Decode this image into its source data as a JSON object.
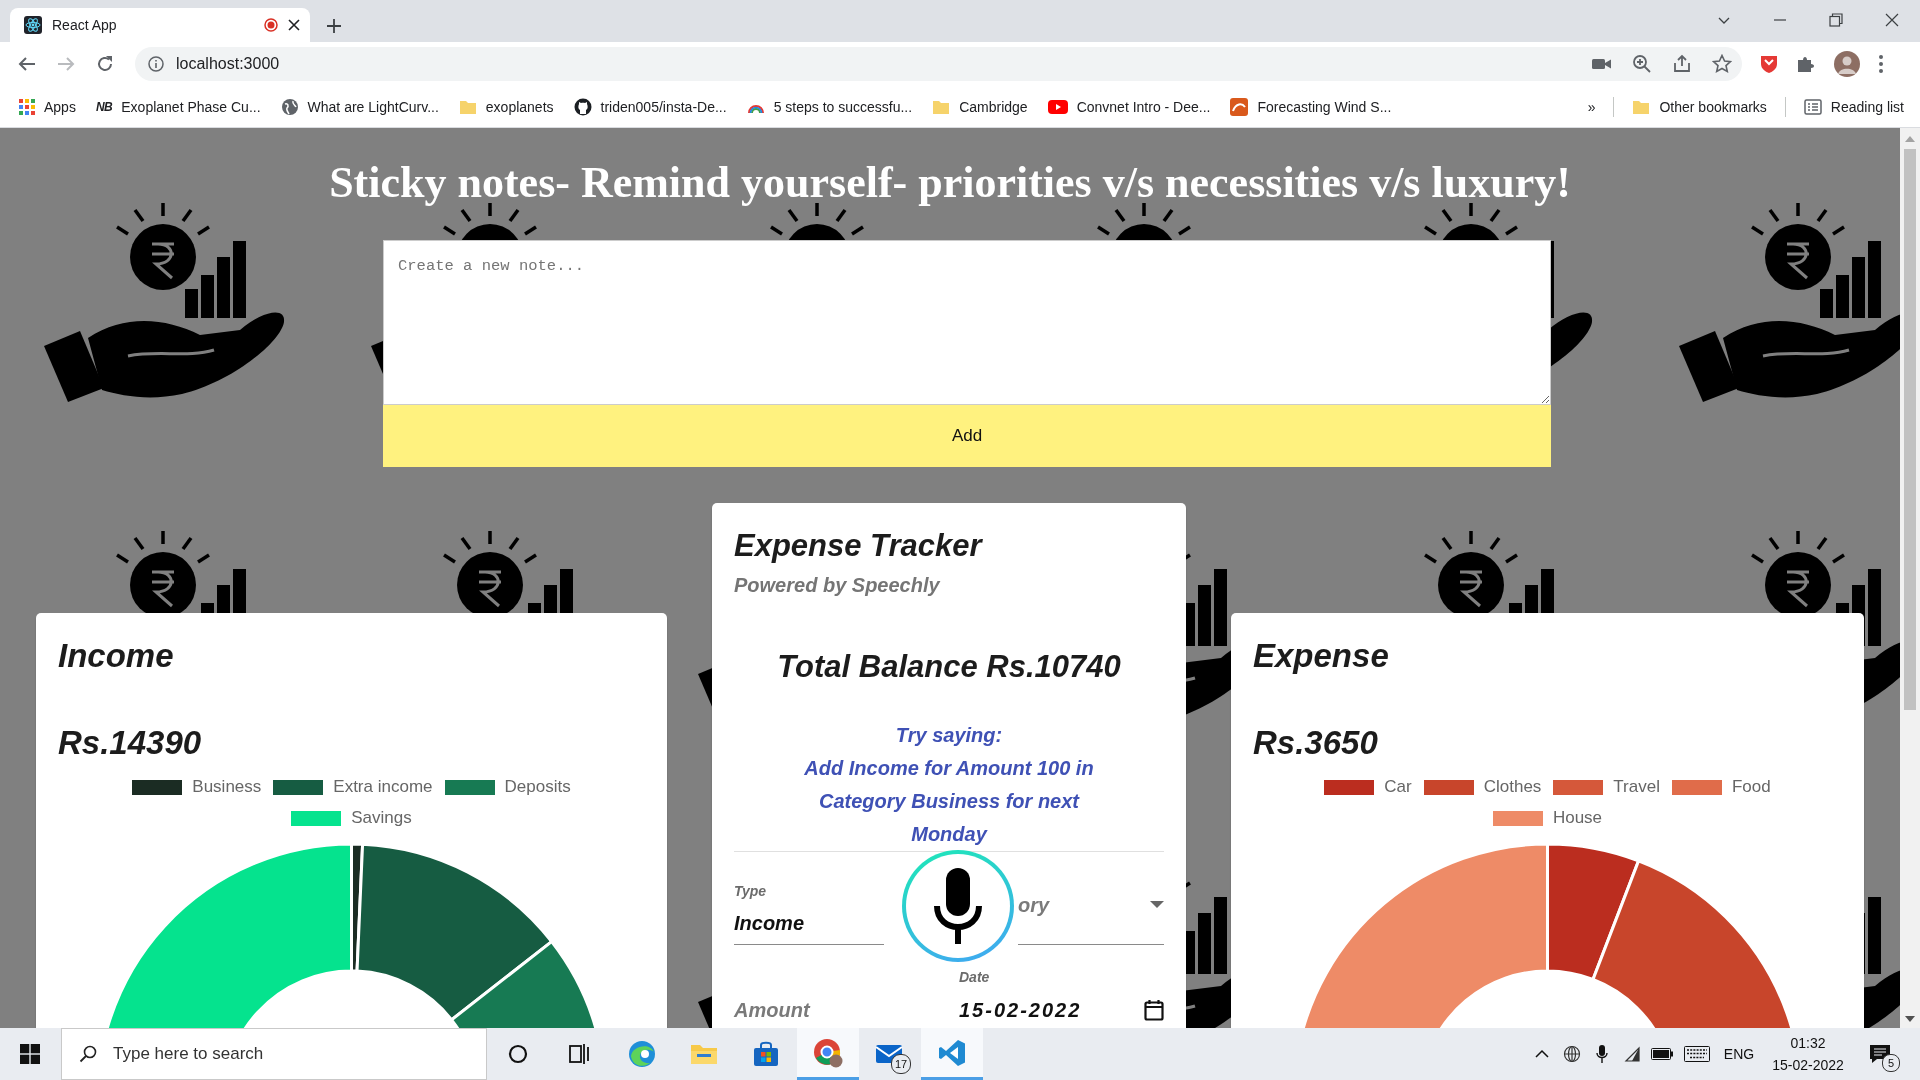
{
  "browser": {
    "tabs": [
      {
        "title": "React App",
        "selected": true,
        "recording": true
      }
    ],
    "address": "localhost:3000",
    "bookmarks": [
      {
        "kind": "apps",
        "label": "Apps"
      },
      {
        "kind": "text",
        "favicon_text": "NB",
        "label": "Exoplanet Phase Cu..."
      },
      {
        "kind": "globe",
        "label": "What are LightCurv..."
      },
      {
        "kind": "folder",
        "label": "exoplanets"
      },
      {
        "kind": "dark-circle",
        "label": "triden005/insta-De..."
      },
      {
        "kind": "rainbow",
        "label": "5 steps to successfu..."
      },
      {
        "kind": "folder",
        "label": "Cambridge"
      },
      {
        "kind": "play",
        "label": "Convnet Intro - Dee..."
      },
      {
        "kind": "orange-tile",
        "label": "Forecasting Wind S..."
      }
    ],
    "overflow": "»",
    "other_bookmarks": "Other bookmarks",
    "reading_list": "Reading list"
  },
  "page": {
    "heading": "Sticky notes- Remind yourself- priorities v/s necessities v/s luxury!",
    "note_input": {
      "placeholder": "Create a new note..."
    },
    "add_button": "Add",
    "income": {
      "title": "Income",
      "amount": "Rs.14390",
      "legend": [
        {
          "label": "Business",
          "color": "#1b2c23"
        },
        {
          "label": "Extra income",
          "color": "#165c42"
        },
        {
          "label": "Deposits",
          "color": "#177a53"
        },
        {
          "label": "Savings",
          "color": "#05e38e"
        }
      ]
    },
    "tracker": {
      "title": "Expense Tracker",
      "subtitle": "Powered by Speechly",
      "balance": "Total Balance Rs.10740",
      "hint_title": "Try saying:",
      "hint": "Add Income for Amount 100 in Category Business for next Monday",
      "type_field": {
        "label": "Type",
        "value": "Income"
      },
      "category_field": {
        "placeholder": "ory"
      },
      "amount_field": {
        "placeholder": "Amount"
      },
      "date_field": {
        "label": "Date",
        "value": "15-02-2022"
      }
    },
    "expense": {
      "title": "Expense",
      "amount": "Rs.3650",
      "legend": [
        {
          "label": "Car",
          "color": "#bb2d1f"
        },
        {
          "label": "Clothes",
          "color": "#c8452b"
        },
        {
          "label": "Travel",
          "color": "#d5583a"
        },
        {
          "label": "Food",
          "color": "#e06c4a"
        },
        {
          "label": "House",
          "color": "#ee8b67"
        }
      ]
    }
  },
  "taskbar": {
    "search_placeholder": "Type here to search",
    "apps": [
      {
        "kind": "cortana",
        "running": false
      },
      {
        "kind": "task-view",
        "running": false
      },
      {
        "kind": "edge",
        "running": false
      },
      {
        "kind": "explorer",
        "running": false
      },
      {
        "kind": "store",
        "running": false
      },
      {
        "kind": "chrome",
        "running": true
      },
      {
        "kind": "mail",
        "running": false,
        "badge": "17"
      },
      {
        "kind": "vscode",
        "running": true
      }
    ],
    "language": "ENG",
    "time": "01:32",
    "date": "15-02-2022",
    "notifications": "5"
  }
}
